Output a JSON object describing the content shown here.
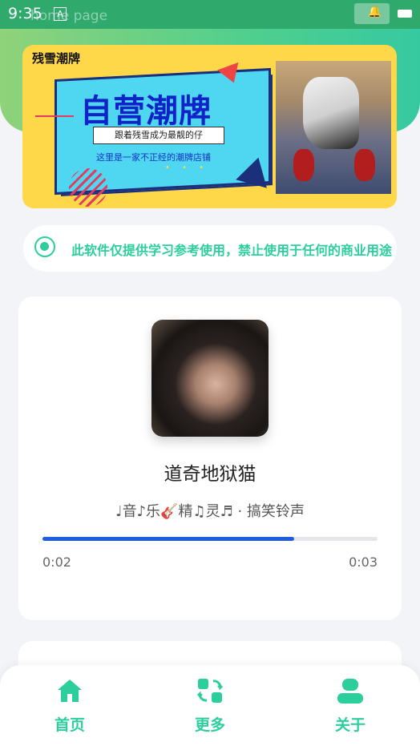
{
  "status_bar": {
    "time": "9:35",
    "ghost_title": "home page",
    "notification_icon": "a-icon"
  },
  "banner": {
    "brand": "残雪潮牌",
    "headline": "自营潮牌",
    "tagline": "跟着残雪成为最靓的仔",
    "subline": "这里是一家不正经的潮牌店铺",
    "dots": "• • •"
  },
  "notice": {
    "text": "此软件仅提供学习参考使用，禁止使用于任何的商业用途"
  },
  "player": {
    "title": "道奇地狱猫",
    "artist": "♩音♪乐🎸精♫灵♬ · 搞笑铃声",
    "progress_fraction": 0.75,
    "time_current": "0:02",
    "time_total": "0:03"
  },
  "tabbar": {
    "items": [
      {
        "label": "首页",
        "icon": "home-icon"
      },
      {
        "label": "更多",
        "icon": "more-swap-icon"
      },
      {
        "label": "关于",
        "icon": "user-icon"
      }
    ]
  },
  "colors": {
    "accent": "#2ccf9c",
    "progress": "#1f5de0",
    "header_green": "#4fcf8e"
  }
}
